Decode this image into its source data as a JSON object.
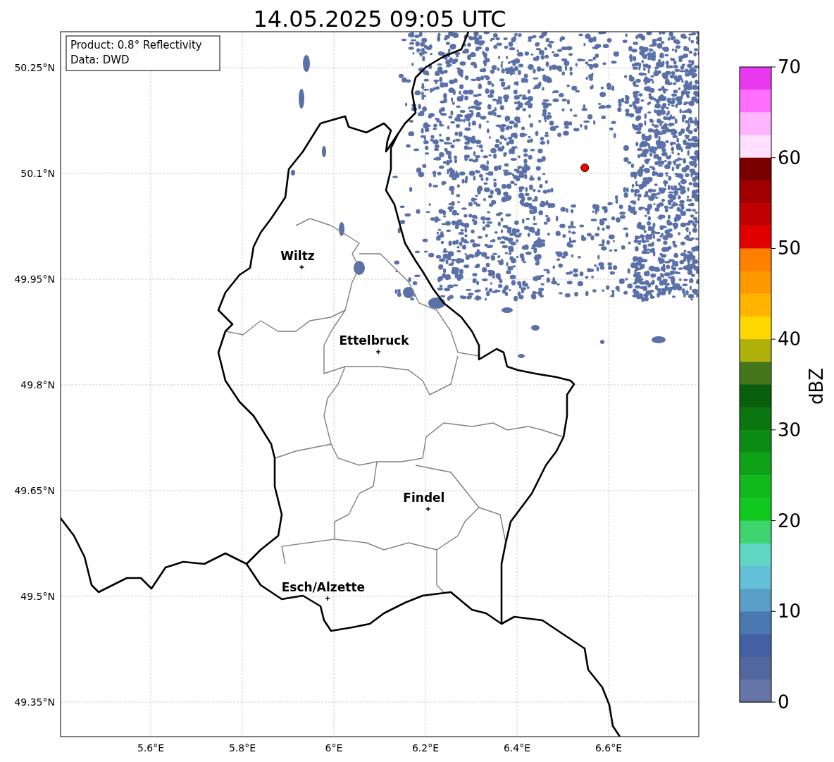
{
  "title": "14.05.2025 09:05 UTC",
  "info_box": [
    "Product: 0.8° Reflectivity",
    "Data: DWD"
  ],
  "map": {
    "lat_ticks": [
      "50.25°N",
      "50.1°N",
      "49.95°N",
      "49.8°N",
      "49.65°N",
      "49.5°N",
      "49.35°N"
    ],
    "lon_ticks": [
      "5.6°E",
      "5.8°E",
      "6°E",
      "6.2°E",
      "6.4°E",
      "6.6°E"
    ],
    "cities": [
      {
        "name": "Wiltz"
      },
      {
        "name": "Ettelbruck"
      },
      {
        "name": "Findel"
      },
      {
        "name": "Esch/Alzette"
      }
    ]
  },
  "colorbar": {
    "label": "dBZ",
    "ticks": [
      "70",
      "60",
      "50",
      "40",
      "30",
      "20",
      "10",
      "0"
    ],
    "bins": [
      {
        "color": "#e838f0"
      },
      {
        "color": "#ff6eff"
      },
      {
        "color": "#ffb4ff"
      },
      {
        "color": "#ffe0ff"
      },
      {
        "color": "#7a0000"
      },
      {
        "color": "#a00000"
      },
      {
        "color": "#c00000"
      },
      {
        "color": "#e00000"
      },
      {
        "color": "#ff7f00"
      },
      {
        "color": "#ff9900"
      },
      {
        "color": "#ffb400"
      },
      {
        "color": "#ffd700"
      },
      {
        "color": "#b0b00a"
      },
      {
        "color": "#46761b"
      },
      {
        "color": "#0a5f0c"
      },
      {
        "color": "#0b7510"
      },
      {
        "color": "#0d8c14"
      },
      {
        "color": "#0fa217"
      },
      {
        "color": "#11b91c"
      },
      {
        "color": "#11c81e"
      },
      {
        "color": "#3dd46e"
      },
      {
        "color": "#5fd7c4"
      },
      {
        "color": "#62c0d8"
      },
      {
        "color": "#58a0c8"
      },
      {
        "color": "#4a78b0"
      },
      {
        "color": "#4460a2"
      },
      {
        "color": "#51679f"
      },
      {
        "color": "#6575a8"
      }
    ]
  }
}
